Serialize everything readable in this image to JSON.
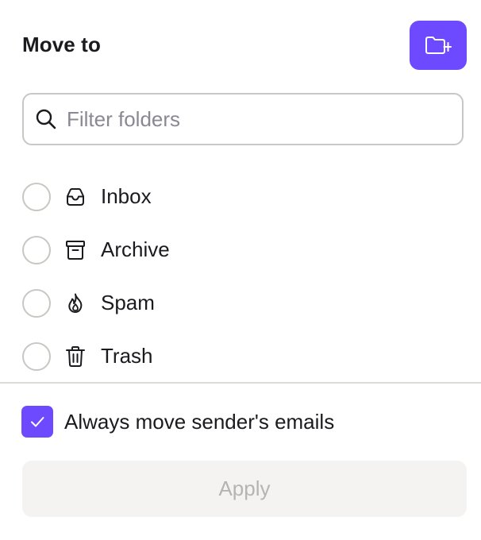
{
  "header": {
    "title": "Move to",
    "new_folder_icon": "folder-plus-icon"
  },
  "search": {
    "value": "",
    "placeholder": "Filter folders",
    "icon": "search-icon"
  },
  "folders": [
    {
      "label": "Inbox",
      "icon": "inbox-icon",
      "selected": false
    },
    {
      "label": "Archive",
      "icon": "archive-icon",
      "selected": false
    },
    {
      "label": "Spam",
      "icon": "fire-icon",
      "selected": false
    },
    {
      "label": "Trash",
      "icon": "trash-icon",
      "selected": false
    }
  ],
  "always_move": {
    "label": "Always move sender's emails",
    "checked": true
  },
  "apply": {
    "label": "Apply",
    "disabled": true
  },
  "colors": {
    "accent": "#6d4aff",
    "border": "#c9c7c3",
    "text": "#1b1b1f",
    "placeholder": "#8a8893",
    "disabled_bg": "#f4f3f1",
    "disabled_text": "#b6b4b0"
  }
}
